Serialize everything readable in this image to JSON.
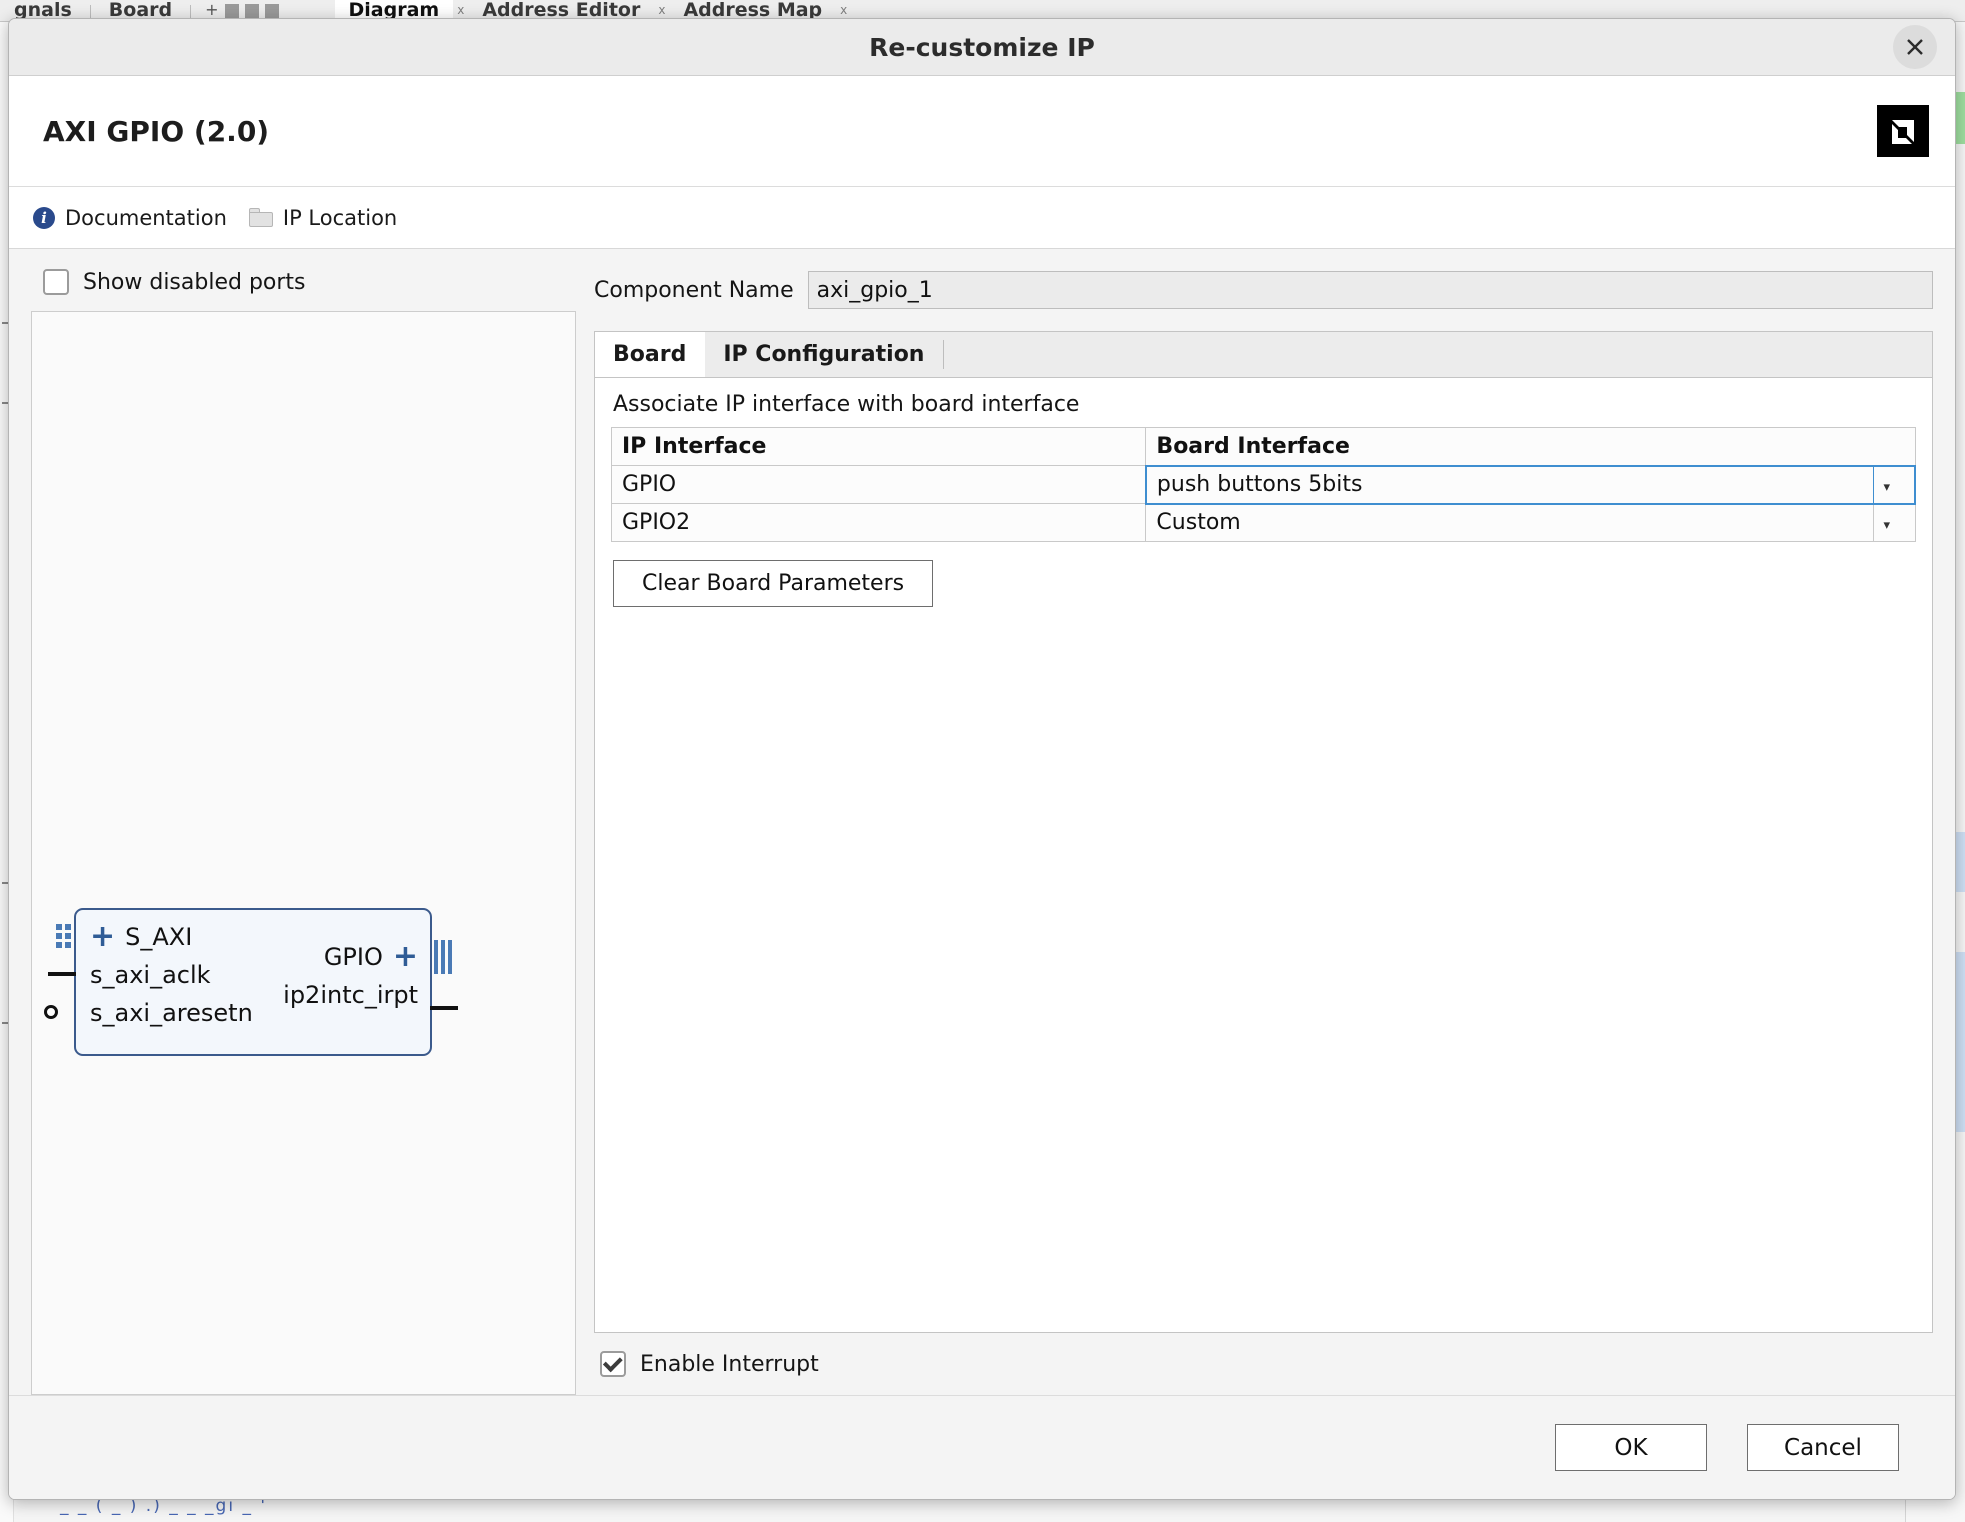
{
  "background": {
    "tabs": [
      {
        "label": "gnals"
      },
      {
        "label": "Board"
      },
      {
        "label": "Diagram",
        "selected": true
      },
      {
        "label": "Address Editor"
      },
      {
        "label": "Address Map"
      }
    ],
    "bottom_text": "_  _        (  _      ) .)   _  _          _gi   _ '",
    "close_symbol": "x"
  },
  "dialog": {
    "title": "Re-customize IP",
    "close_icon": "close-icon",
    "ip_title": "AXI GPIO (2.0)",
    "vendor_logo": "amd-xilinx-logo",
    "toolbar": {
      "documentation_label": "Documentation",
      "documentation_icon": "info-icon",
      "ip_location_label": "IP Location",
      "ip_location_icon": "folder-icon"
    },
    "preview": {
      "show_disabled_ports_label": "Show disabled ports",
      "show_disabled_ports_checked": false,
      "symbol": {
        "left_pins": [
          {
            "label": "S_AXI",
            "type": "bus",
            "plus": "+"
          },
          {
            "label": "s_axi_aclk",
            "type": "clock"
          },
          {
            "label": "s_axi_aresetn",
            "type": "reset_n"
          }
        ],
        "right_pins": [
          {
            "label": "GPIO",
            "type": "bus",
            "plus": "+"
          },
          {
            "label": "ip2intc_irpt",
            "type": "signal"
          }
        ]
      }
    },
    "component_name_label": "Component Name",
    "component_name_value": "axi_gpio_1",
    "tabs": [
      {
        "label": "Board",
        "active": true
      },
      {
        "label": "IP Configuration",
        "active": false
      }
    ],
    "board_tab": {
      "description": "Associate IP interface with board interface",
      "table": {
        "headers": [
          "IP Interface",
          "Board Interface"
        ],
        "rows": [
          {
            "ip_interface": "GPIO",
            "board_interface": "push buttons 5bits",
            "selected": true,
            "caret": "▾"
          },
          {
            "ip_interface": "GPIO2",
            "board_interface": "Custom",
            "selected": false,
            "caret": "▾"
          }
        ]
      },
      "clear_button_label": "Clear Board Parameters"
    },
    "enable_interrupt_label": "Enable Interrupt",
    "enable_interrupt_checked": true,
    "footer": {
      "ok_label": "OK",
      "cancel_label": "Cancel"
    }
  },
  "colors": {
    "accent_selection": "#3f8ed0",
    "symbol_border": "#3b5a8c",
    "symbol_fill": "#f3f7fc",
    "bus_blue": "#4a7ab5",
    "info_blue": "#2a4a8c"
  }
}
